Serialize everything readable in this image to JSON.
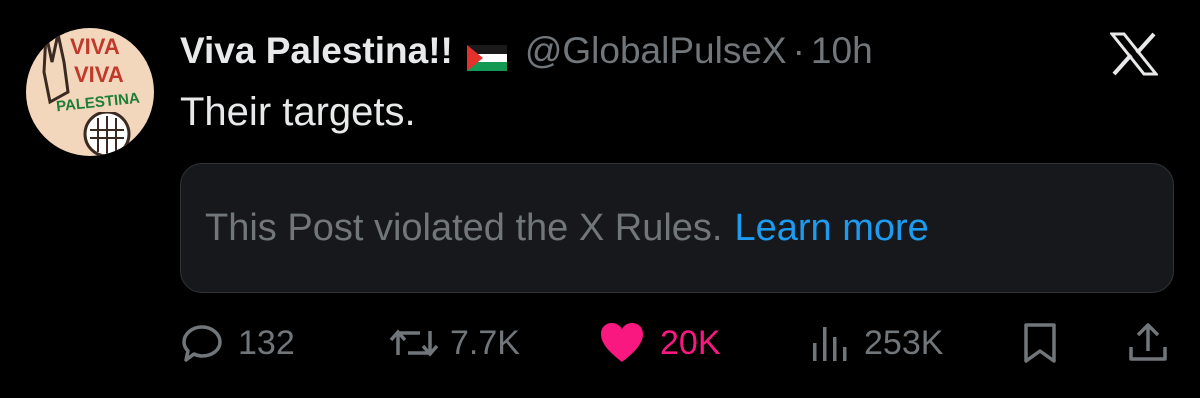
{
  "post": {
    "display_name": "Viva Palestina!!",
    "handle": "@GlobalPulseX",
    "separator": "·",
    "time": "10h",
    "text": "Their targets.",
    "avatar_text": [
      "VIVA",
      "VIVA",
      "PALESTINA"
    ]
  },
  "notice": {
    "text": "This Post violated the X Rules.",
    "link": "Learn more"
  },
  "actions": {
    "replies": "132",
    "reposts": "7.7K",
    "likes": "20K",
    "views": "253K"
  },
  "colors": {
    "background": "#000000",
    "text": "#e7e9ea",
    "muted": "#71767b",
    "link": "#1d9bf0",
    "like": "#f91880"
  },
  "icons": [
    "x-logo-icon",
    "reply-icon",
    "repost-icon",
    "heart-icon",
    "views-icon",
    "bookmark-icon",
    "share-icon",
    "palestine-flag-icon"
  ]
}
